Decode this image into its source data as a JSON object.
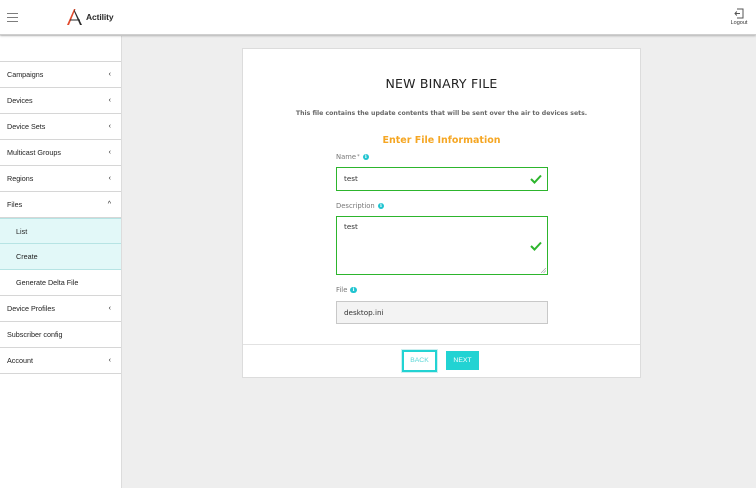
{
  "header": {
    "brand": "Actility",
    "logout_label": "Logout"
  },
  "sidebar": {
    "items": [
      {
        "label": "Campaigns",
        "chevron": "‹"
      },
      {
        "label": "Devices",
        "chevron": "‹"
      },
      {
        "label": "Device Sets",
        "chevron": "‹"
      },
      {
        "label": "Multicast Groups",
        "chevron": "‹"
      },
      {
        "label": "Regions",
        "chevron": "‹"
      },
      {
        "label": "Files",
        "chevron": "^"
      }
    ],
    "files_submenu": [
      {
        "label": "List"
      },
      {
        "label": "Create"
      },
      {
        "label": "Generate Delta File"
      }
    ],
    "bottom_items": [
      {
        "label": "Device Profiles",
        "chevron": "‹"
      },
      {
        "label": "Subscriber config",
        "chevron": ""
      },
      {
        "label": "Account",
        "chevron": "‹"
      }
    ]
  },
  "form": {
    "title": "NEW BINARY FILE",
    "subtitle": "This file contains the update contents that will be sent over the air to devices sets.",
    "section_title": "Enter File Information",
    "name": {
      "label": "Name",
      "required_mark": "*",
      "value": "test"
    },
    "description": {
      "label": "Description",
      "value": "test"
    },
    "file": {
      "label": "File",
      "value": "desktop.ini"
    },
    "back_label": "BACK",
    "next_label": "NEXT"
  },
  "colors": {
    "accent": "#22d3d3",
    "section_title": "#f5a623",
    "valid": "#2db52d",
    "info_icon": "#20c4d0",
    "active_nav_bg": "#e2f8f8"
  },
  "icons": {
    "menu": "hamburger-menu-icon",
    "logout": "logout-icon",
    "info": "info-icon",
    "valid": "checkmark-icon"
  }
}
